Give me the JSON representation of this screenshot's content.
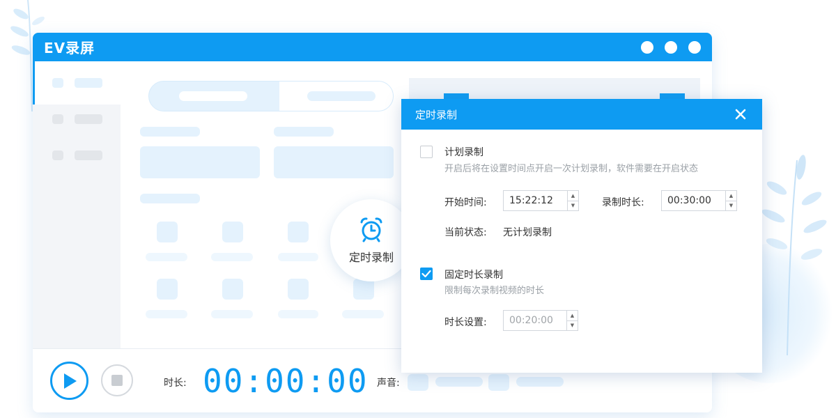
{
  "window": {
    "title": "EV录屏"
  },
  "bottom_bar": {
    "duration_label": "时长:",
    "timer_value": "00:00:00",
    "audio_label": "声音:"
  },
  "timer_badge": {
    "label": "定时录制"
  },
  "dialog": {
    "title": "定时录制",
    "scheduled": {
      "checked": false,
      "title": "计划录制",
      "description": "开启后将在设置时间点开启一次计划录制，软件需要在开启状态",
      "start_time_label": "开始时间:",
      "start_time_value": "15:22:12",
      "record_duration_label": "录制时长:",
      "record_duration_value": "00:30:00",
      "status_label": "当前状态:",
      "status_value": "无计划录制"
    },
    "fixed_duration": {
      "checked": true,
      "title": "固定时长录制",
      "description": "限制每次录制视频的时长",
      "duration_setting_label": "时长设置:",
      "duration_setting_value": "00:20:00"
    }
  },
  "colors": {
    "accent": "#0e9bf2",
    "placeholder": "#e4f2fd"
  },
  "icons": {
    "close": "close-icon",
    "play": "play-icon",
    "stop": "stop-icon",
    "alarm": "alarm-clock-icon",
    "check": "check-icon"
  }
}
